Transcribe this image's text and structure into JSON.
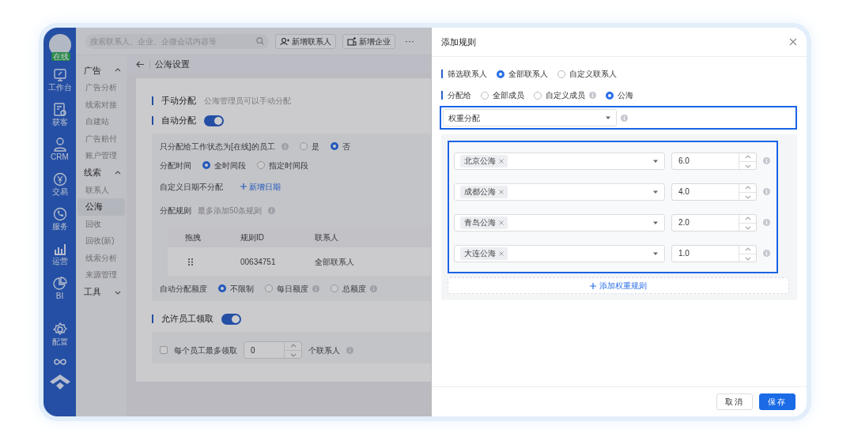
{
  "rail": {
    "avatar_status": "在线",
    "items": [
      {
        "kind": "desk",
        "label": "工作台"
      },
      {
        "kind": "acquire",
        "label": "获客"
      },
      {
        "kind": "person",
        "label": "CRM"
      },
      {
        "kind": "money",
        "label": "交易"
      },
      {
        "kind": "phone",
        "label": "服务"
      },
      {
        "kind": "chart",
        "label": "运营"
      },
      {
        "kind": "pie",
        "label": "BI"
      },
      {
        "kind": "gear",
        "label": "配置"
      }
    ]
  },
  "topbar": {
    "search": {
      "placeholder": "搜索联系人、企业、企微会话内容等"
    },
    "buttons": [
      {
        "kind": "contact",
        "label": "新增联系人"
      },
      {
        "kind": "company",
        "label": "新增企业"
      }
    ],
    "more": "···"
  },
  "subnav": [
    {
      "title": "广告",
      "expanded": true,
      "items": [
        {
          "label": "广告分析",
          "selected": false
        },
        {
          "label": "线索对接",
          "selected": false
        },
        {
          "label": "自建站",
          "selected": false
        },
        {
          "label": "广告赔付",
          "selected": false
        },
        {
          "label": "账户管理",
          "selected": false
        }
      ]
    },
    {
      "title": "线索",
      "expanded": true,
      "items": [
        {
          "label": "联系人",
          "selected": false
        },
        {
          "label": "公海",
          "selected": true
        },
        {
          "label": "回收",
          "selected": false
        },
        {
          "label": "回收(新)",
          "selected": false
        },
        {
          "label": "线索分析",
          "selected": false
        },
        {
          "label": "来源管理",
          "selected": false
        }
      ]
    },
    {
      "title": "工具",
      "expanded": false
    }
  ],
  "page": {
    "title": "公海设置",
    "manual": {
      "title": "手动分配",
      "hint": "公海管理员可以手动分配"
    },
    "auto": {
      "title": "自动分配",
      "on": true
    },
    "online_only": {
      "label": "只分配给工作状态为[在线]的员工",
      "info": true,
      "options": [
        {
          "label": "是",
          "selected": false
        },
        {
          "label": "否",
          "selected": true
        }
      ]
    },
    "time": {
      "label": "分配时间",
      "options": [
        {
          "label": "全时间段",
          "selected": true
        },
        {
          "label": "指定时间段",
          "selected": false
        }
      ]
    },
    "custom_date": {
      "label": "自定义日期不分配",
      "link": "新增日期"
    },
    "rules": {
      "label": "分配规则",
      "hint": "最多添加50条规则",
      "columns": [
        "拖拽",
        "规则ID",
        "联系人"
      ],
      "rows": [
        {
          "id": "00634751",
          "contact": "全部联系人"
        }
      ]
    },
    "quota": {
      "label": "自动分配额度",
      "options": [
        {
          "label": "不限制",
          "selected": true
        },
        {
          "label": "每日额度",
          "selected": false,
          "info": true
        },
        {
          "label": "总额度",
          "selected": false,
          "info": true
        }
      ]
    },
    "claim": {
      "title": "允许员工领取",
      "on": true
    },
    "claim_limit": {
      "checked": false,
      "label": "每个员工最多领取",
      "value": "0",
      "suffix": "个联系人"
    }
  },
  "drawer": {
    "title": "添加规则",
    "filter": {
      "label": "筛选联系人",
      "options": [
        {
          "label": "全部联系人",
          "selected": true
        },
        {
          "label": "自定义联系人",
          "selected": false
        }
      ]
    },
    "assign": {
      "label": "分配给",
      "options": [
        {
          "label": "全部成员",
          "selected": false
        },
        {
          "label": "自定义成员",
          "selected": false,
          "info": true
        },
        {
          "label": "公海",
          "selected": true
        }
      ]
    },
    "mode": {
      "value": "权重分配",
      "highlighted": true
    },
    "weights": {
      "highlighted": true,
      "rows": [
        {
          "tag": "北京公海",
          "value": "6.0"
        },
        {
          "tag": "成都公海",
          "value": "4.0"
        },
        {
          "tag": "青岛公海",
          "value": "2.0"
        },
        {
          "tag": "大连公海",
          "value": "1.0"
        }
      ]
    },
    "add_rule": "添加权重规则",
    "buttons": [
      {
        "kind": "secondary",
        "label": "取消"
      },
      {
        "kind": "primary",
        "label": "保存"
      }
    ]
  }
}
